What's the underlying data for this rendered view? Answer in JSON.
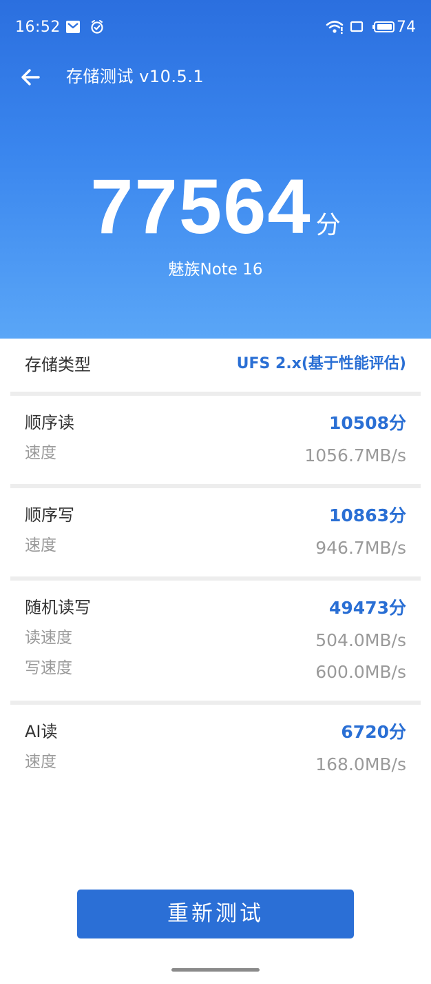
{
  "status_bar": {
    "time": "16:52",
    "battery_level": "74",
    "icons": [
      "mail-icon",
      "alarm-icon",
      "wifi-icon",
      "screen-icon",
      "battery-icon"
    ]
  },
  "header": {
    "title": "存储测试 v10.5.1"
  },
  "summary": {
    "total_score": "77564",
    "score_unit": "分",
    "device": "魅族Note 16"
  },
  "storage_type": {
    "label": "存储类型",
    "value": "UFS 2.x(基于性能评估)"
  },
  "results": [
    {
      "name": "顺序读",
      "score": "10508分",
      "metrics": [
        {
          "label": "速度",
          "value": "1056.7MB/s"
        }
      ]
    },
    {
      "name": "顺序写",
      "score": "10863分",
      "metrics": [
        {
          "label": "速度",
          "value": "946.7MB/s"
        }
      ]
    },
    {
      "name": "随机读写",
      "score": "49473分",
      "metrics": [
        {
          "label": "读速度",
          "value": "504.0MB/s"
        },
        {
          "label": "写速度",
          "value": "600.0MB/s"
        }
      ]
    },
    {
      "name": "AI读",
      "score": "6720分",
      "metrics": [
        {
          "label": "速度",
          "value": "168.0MB/s"
        }
      ]
    }
  ],
  "actions": {
    "retest_label": "重新测试"
  },
  "colors": {
    "header_gradient_top": "#2b6fdf",
    "header_gradient_bottom": "#5aa6f7",
    "accent_blue": "#2a6fd4",
    "button_blue": "#2b6fd6",
    "muted_text": "#9a9a9a",
    "divider": "#ededed"
  }
}
